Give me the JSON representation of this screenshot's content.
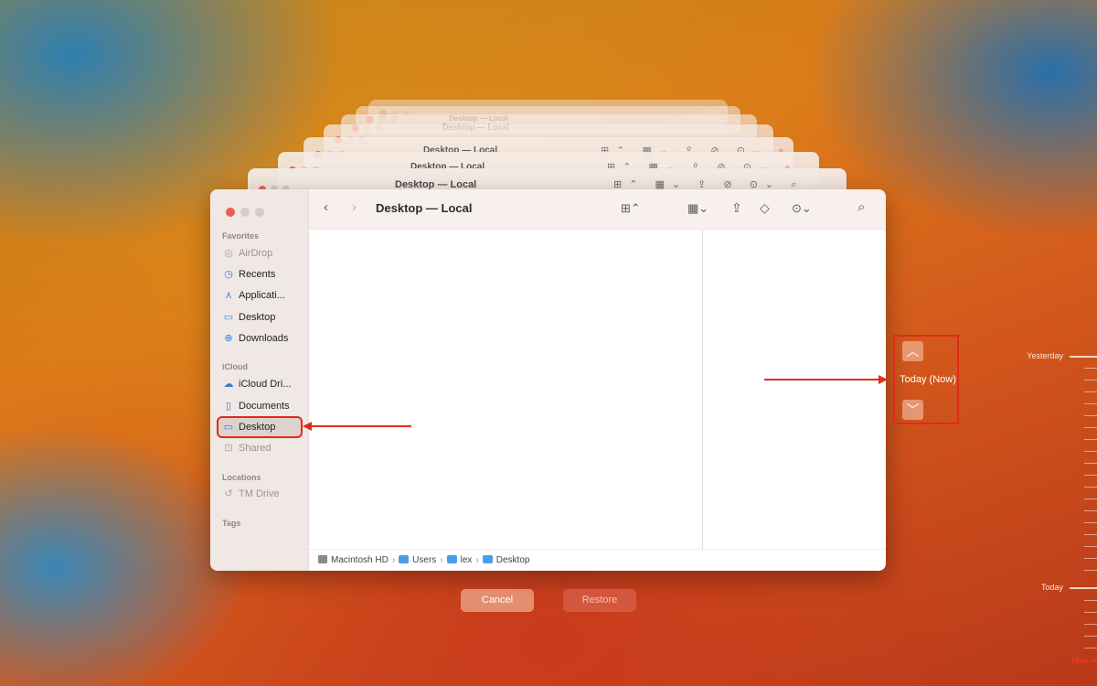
{
  "window": {
    "title": "Desktop — Local",
    "ghost_title": "Desktop — Local"
  },
  "sidebar": {
    "favorites_title": "Favorites",
    "favorites": [
      {
        "label": "AirDrop",
        "icon": "airdrop-icon",
        "dim": true
      },
      {
        "label": "Recents",
        "icon": "clock-icon",
        "dim": false
      },
      {
        "label": "Applicati...",
        "icon": "applications-icon",
        "dim": false
      },
      {
        "label": "Desktop",
        "icon": "desktop-icon",
        "dim": false
      },
      {
        "label": "Downloads",
        "icon": "downloads-icon",
        "dim": false
      }
    ],
    "icloud_title": "iCloud",
    "icloud": [
      {
        "label": "iCloud Dri...",
        "icon": "cloud-icon"
      },
      {
        "label": "Documents",
        "icon": "document-icon"
      },
      {
        "label": "Desktop",
        "icon": "desktop-icon",
        "selected": true
      },
      {
        "label": "Shared",
        "icon": "shared-folder-icon",
        "dim": true
      }
    ],
    "locations_title": "Locations",
    "locations": [
      {
        "label": "TM Drive",
        "icon": "time-machine-icon",
        "dim": true
      }
    ],
    "tags_title": "Tags"
  },
  "pathbar": {
    "segments": [
      "Macintosh HD",
      "Users",
      "lex",
      "Desktop"
    ]
  },
  "buttons": {
    "cancel": "Cancel",
    "restore": "Restore"
  },
  "navigator": {
    "label": "Today (Now)"
  },
  "timeline": {
    "yesterday": "Yesterday",
    "today": "Today",
    "now": "Now"
  },
  "colors": {
    "annotation": "#e02a1a",
    "selection": "#dcd3cf"
  }
}
